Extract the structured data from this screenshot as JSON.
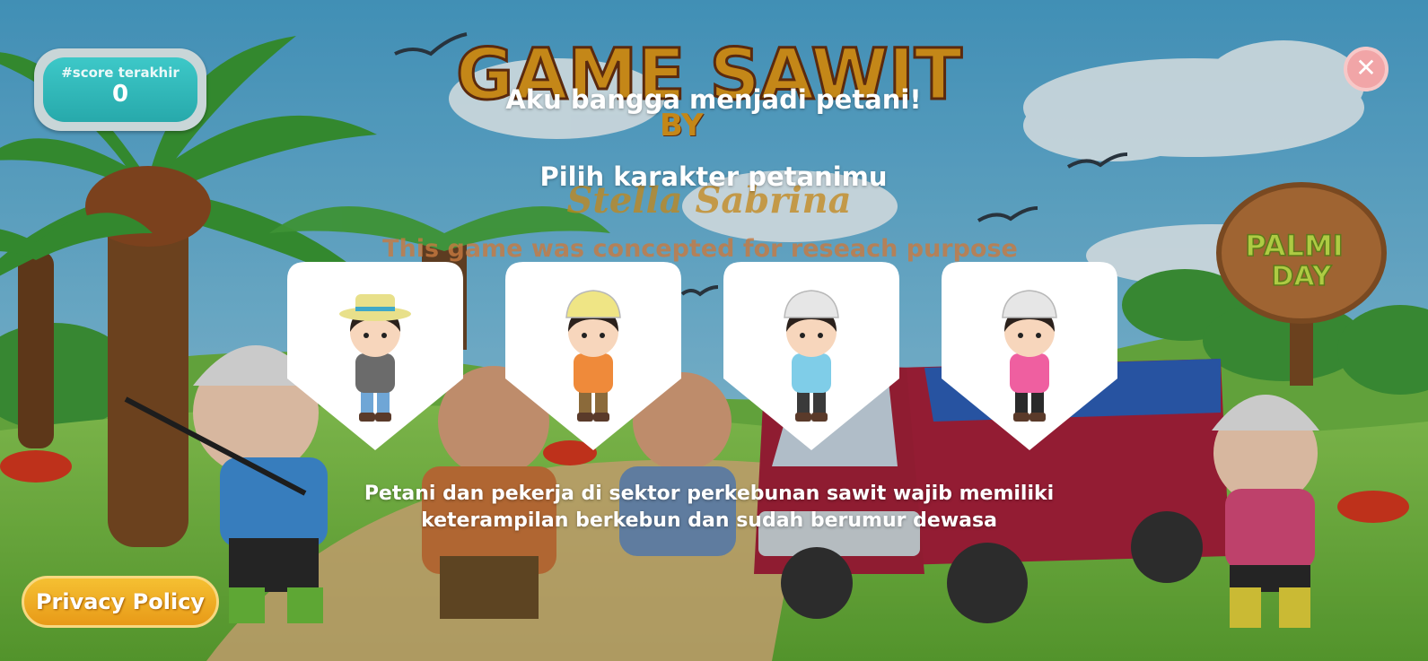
{
  "logo": {
    "title": "GAME SAWIT",
    "by": "BY",
    "author": "Stella Sabrina",
    "credit": "This game was concepted for reseach purpose"
  },
  "sign": {
    "text_line1": "PALMI",
    "text_line2": "DAY"
  },
  "score": {
    "label": "#score terakhir",
    "value": "0"
  },
  "dialog": {
    "headline": "Aku bangga menjadi petani!",
    "prompt": "Pilih karakter petanimu",
    "description_line1": "Petani dan pekerja di sektor perkebunan sawit wajib memiliki",
    "description_line2": "keterampilan berkebun dan sudah berumur dewasa"
  },
  "characters": [
    {
      "id": "farmer-woman-straw-hat",
      "hat": "#e8e08a",
      "shirt": "#6b6b6b",
      "pants": "#6fa6d6"
    },
    {
      "id": "farmer-boy-orange",
      "hat": "#efe585",
      "shirt": "#ef8a3a",
      "pants": "#8b6a3a"
    },
    {
      "id": "worker-boy-helmet",
      "hat": "#e6e6e6",
      "shirt": "#7fcde8",
      "pants": "#3a3a3a"
    },
    {
      "id": "worker-girl-helmet",
      "hat": "#e6e6e6",
      "shirt": "#ef5fa0",
      "pants": "#2a2a2a"
    }
  ],
  "buttons": {
    "privacy": "Privacy Policy",
    "close": "✕"
  },
  "colors": {
    "sky": "#5fb3d9",
    "grass": "#7cc04a",
    "score_teal": "#2fb8ba",
    "privacy_orange": "#ec9f1c",
    "close_pink": "#f1a5a7"
  }
}
